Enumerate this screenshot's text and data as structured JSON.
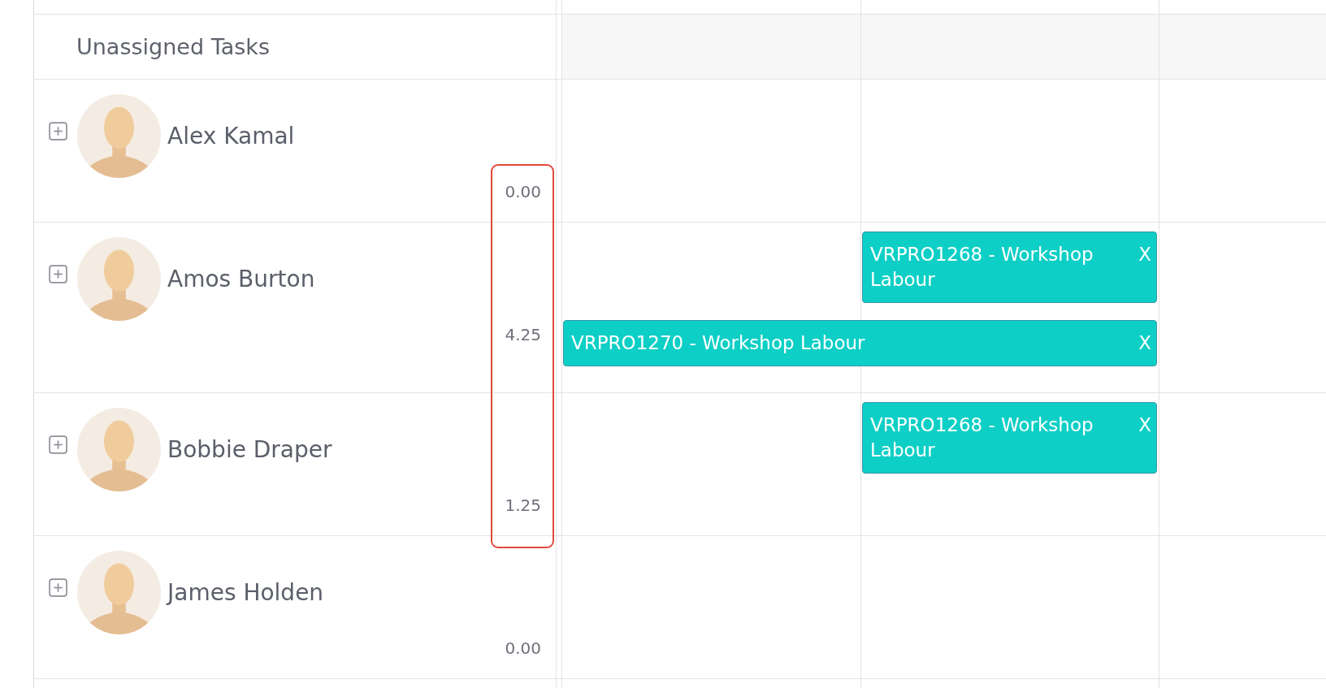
{
  "unassigned_row": {
    "label": "Unassigned Tasks"
  },
  "resources": [
    {
      "name": "Alex Kamal",
      "hours": "0.00",
      "expanded": false,
      "hours_highlighted": true
    },
    {
      "name": "Amos Burton",
      "hours": "4.25",
      "expanded": false,
      "hours_highlighted": true,
      "tasks": [
        {
          "label": "VRPRO1268 - Workshop Labour",
          "remove": "X",
          "columns": [
            false,
            true,
            false
          ]
        },
        {
          "label": "VRPRO1270 - Workshop Labour",
          "remove": "X",
          "columns": [
            true,
            true,
            false
          ]
        }
      ]
    },
    {
      "name": "Bobbie Draper",
      "hours": "1.25",
      "expanded": false,
      "hours_highlighted": true,
      "tasks": [
        {
          "label": "VRPRO1268 - Workshop Labour",
          "remove": "X",
          "columns": [
            false,
            true,
            false
          ]
        }
      ]
    },
    {
      "name": "James Holden",
      "hours": "0.00",
      "expanded": false,
      "hours_highlighted": false
    }
  ]
}
